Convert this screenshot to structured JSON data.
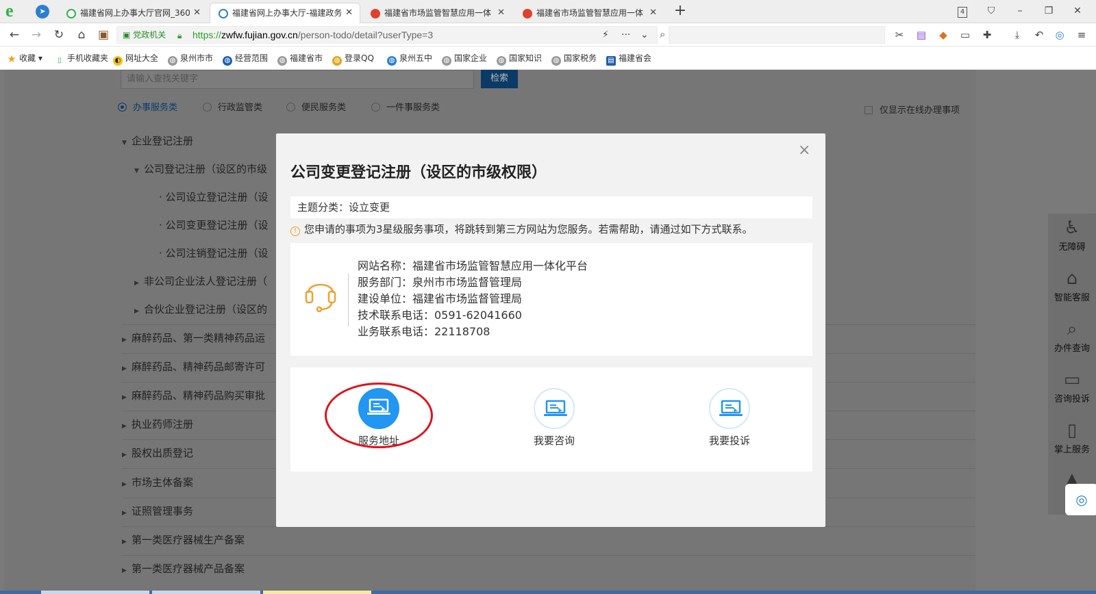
{
  "browser": {
    "tabs": [
      {
        "title": "福建省网上办事大厅官网_360",
        "active": false,
        "icon_color": "#2fb34a"
      },
      {
        "title": "福建省网上办事大厅-福建政务",
        "active": true,
        "icon_color": "#2a7fd4"
      },
      {
        "title": "福建省市场监管智慧应用一体",
        "active": false,
        "icon_color": "#e0412a"
      },
      {
        "title": "福建省市场监管智慧应用一体",
        "active": false,
        "icon_color": "#e0412a"
      }
    ],
    "tab_count_badge": "4",
    "address_badge": "党政机关",
    "url_scheme": "https://",
    "url_host": "zwfw.fujian.gov.cn",
    "url_path": "/person-todo/detail?userType=3",
    "bookmarks": [
      "收藏",
      "手机收藏夹",
      "网址大全",
      "泉州市市",
      "经营范围",
      "福建省市",
      "登录QQ",
      "泉州五中",
      "国家企业",
      "国家知识",
      "国家税务",
      "福建省会"
    ]
  },
  "page": {
    "search_placeholder": "请输入查找关键字",
    "search_button": "检索",
    "categories": [
      {
        "label": "办事服务类",
        "selected": true
      },
      {
        "label": "行政监管类",
        "selected": false
      },
      {
        "label": "便民服务类",
        "selected": false
      },
      {
        "label": "一件事服务类",
        "selected": false
      }
    ],
    "online_only_label": "仅显示在线办理事项",
    "tree": [
      {
        "label": "企业登记注册",
        "level": 0,
        "expanded": true
      },
      {
        "label": "公司登记注册（设区的市级",
        "level": 1,
        "expanded": true
      },
      {
        "label": "· 公司设立登记注册（设",
        "level": 2
      },
      {
        "label": "· 公司变更登记注册（设",
        "level": 2
      },
      {
        "label": "· 公司注销登记注册（设",
        "level": 2
      },
      {
        "label": "非公司企业法人登记注册（",
        "level": 1
      },
      {
        "label": "合伙企业登记注册（设区的",
        "level": 1
      },
      {
        "label": "麻醉药品、第一类精神药品运",
        "level": 0
      },
      {
        "label": "麻醉药品、精神药品邮寄许可",
        "level": 0
      },
      {
        "label": "麻醉药品、精神药品购买审批",
        "level": 0
      },
      {
        "label": "执业药师注册",
        "level": 0
      },
      {
        "label": "股权出质登记",
        "level": 0
      },
      {
        "label": "市场主体备案",
        "level": 0
      },
      {
        "label": "证照管理事务",
        "level": 0
      },
      {
        "label": "第一类医疗器械生产备案",
        "level": 0
      },
      {
        "label": "第一类医疗器械产品备案",
        "level": 0
      }
    ],
    "right_toolbar": [
      {
        "label": "无障碍",
        "icon": "accessibility-icon"
      },
      {
        "label": "智能客服",
        "icon": "robot-icon"
      },
      {
        "label": "办件查询",
        "icon": "search-icon"
      },
      {
        "label": "咨询投诉",
        "icon": "chat-icon"
      },
      {
        "label": "掌上服务",
        "icon": "hand-phone-icon"
      }
    ]
  },
  "modal": {
    "title": "公司变更登记注册（设区的市级权限）",
    "topic": "主题分类：设立变更",
    "notice": "您申请的事项为3星级服务事项，将跳转到第三方网站为您服务。若需帮助，请通过如下方式联系。",
    "info_lines": [
      "网站名称：福建省市场监管智慧应用一体化平台",
      "服务部门：泉州市市场监督管理局",
      "建设单位：福建省市场监督管理局",
      "技术联系电话：0591-62041660",
      "业务联系电话：22118708"
    ],
    "actions": [
      {
        "label": "服务地址",
        "primary": true
      },
      {
        "label": "我要咨询",
        "primary": false
      },
      {
        "label": "我要投诉",
        "primary": false
      }
    ]
  },
  "colors": {
    "primary_blue": "#2196f3",
    "highlight_red": "#e0121a",
    "headset_orange": "#f0a030"
  }
}
